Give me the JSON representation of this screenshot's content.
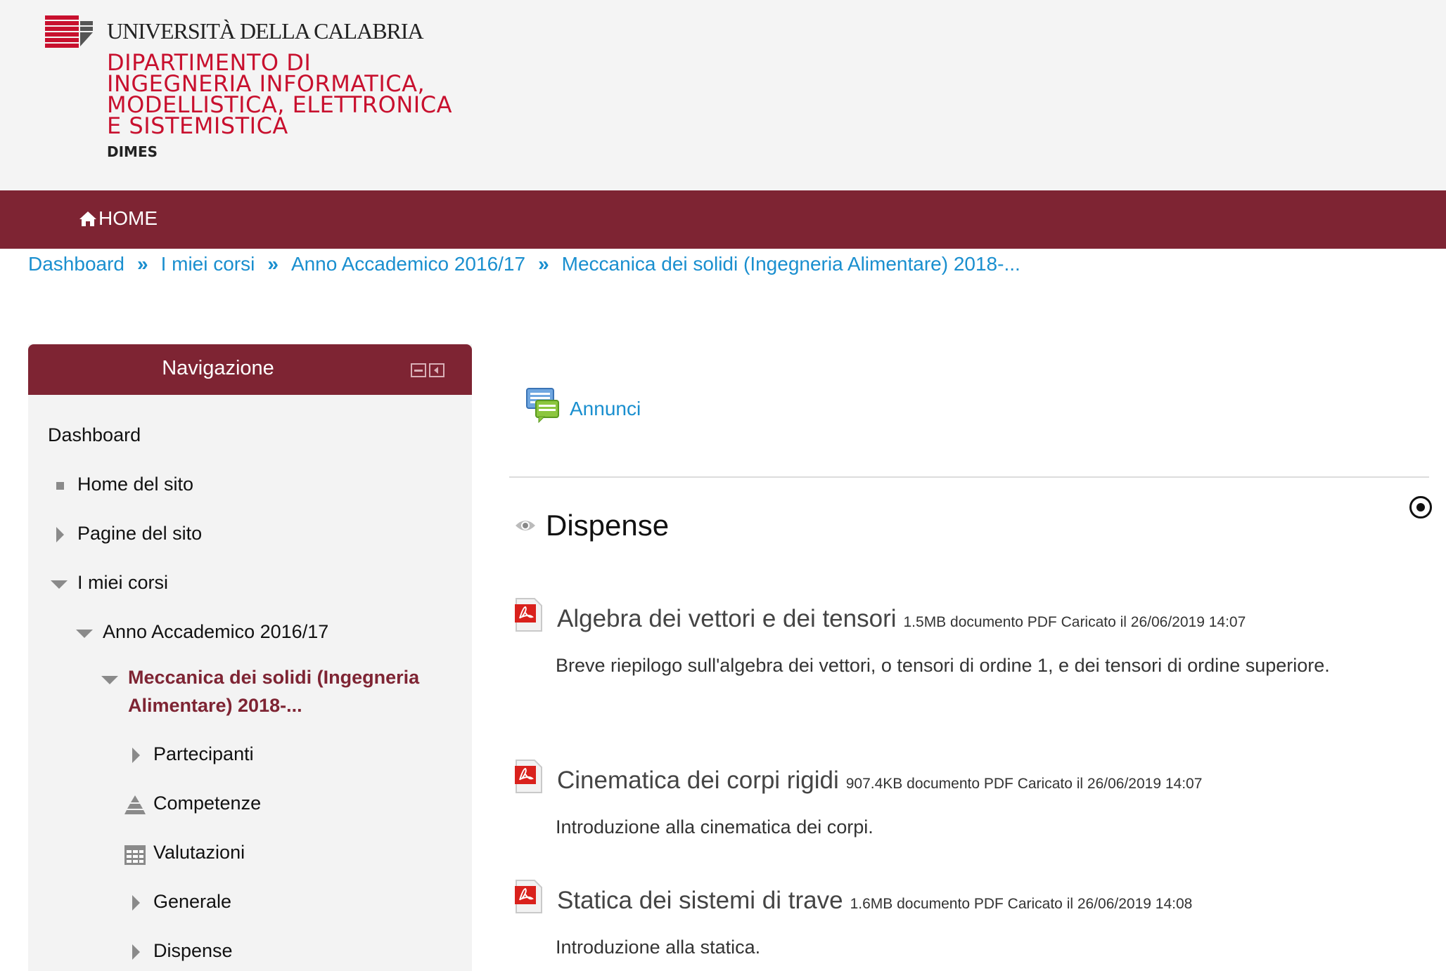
{
  "header": {
    "university": "UNIVERSITÀ DELLA CALABRIA",
    "department_lines": [
      "DIPARTIMENTO DI",
      "INGEGNERIA INFORMATICA,",
      "MODELLISTICA, ELETTRONICA",
      "E SISTEMISTICA"
    ],
    "department_short": "DIMES",
    "brand_color": "#c8102e"
  },
  "navbar": {
    "home_label": "HOME",
    "color": "#7e2433"
  },
  "breadcrumb": [
    "Dashboard",
    "I miei corsi",
    "Anno Accademico 2016/17",
    "Meccanica dei solidi (Ingegneria Alimentare) 2018-..."
  ],
  "navigation": {
    "title": "Navigazione",
    "items": [
      {
        "label": "Dashboard",
        "icon": "none"
      },
      {
        "label": "Home del sito",
        "icon": "square-bullet-icon"
      },
      {
        "label": "Pagine del sito",
        "icon": "expand-arrow-icon"
      },
      {
        "label": "I miei corsi",
        "icon": "collapse-arrow-icon"
      },
      {
        "label": "Anno Accademico 2016/17",
        "icon": "collapse-arrow-icon"
      },
      {
        "label": "Meccanica dei solidi (Ingegneria Alimentare) 2018-...",
        "icon": "collapse-arrow-icon"
      },
      {
        "label": "Partecipanti",
        "icon": "expand-arrow-icon"
      },
      {
        "label": "Competenze",
        "icon": "competencies-icon"
      },
      {
        "label": "Valutazioni",
        "icon": "grades-table-icon"
      },
      {
        "label": "Generale",
        "icon": "expand-arrow-icon"
      },
      {
        "label": "Dispense",
        "icon": "expand-arrow-icon"
      }
    ]
  },
  "main": {
    "forum_label": "Annunci",
    "section_title": "Dispense",
    "resources": [
      {
        "title": "Algebra dei vettori e dei tensori",
        "meta": "1.5MB documento PDF Caricato il 26/06/2019 14:07",
        "description": "Breve riepilogo sull'algebra dei vettori, o tensori di ordine 1, e dei tensori di ordine superiore."
      },
      {
        "title": "Cinematica dei corpi rigidi",
        "meta": "907.4KB documento PDF Caricato il 26/06/2019 14:07",
        "description": "Introduzione alla cinematica dei corpi."
      },
      {
        "title": "Statica dei sistemi di trave",
        "meta": "1.6MB documento PDF Caricato il 26/06/2019 14:08",
        "description": "Introduzione alla statica."
      }
    ]
  }
}
